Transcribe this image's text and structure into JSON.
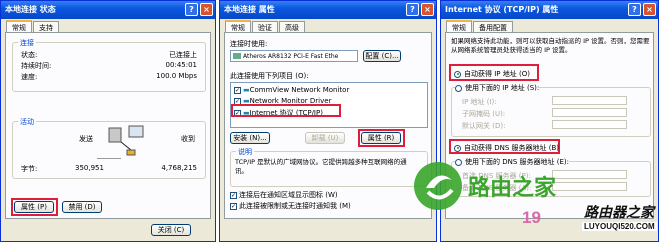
{
  "w1": {
    "title": "本地连接 状态",
    "tabs": [
      "常规",
      "支持"
    ],
    "group_conn": "连接",
    "status_lbl": "状态:",
    "status_val": "已连接上",
    "dur_lbl": "持续时间:",
    "dur_val": "00:45:01",
    "speed_lbl": "速度:",
    "speed_val": "100.0 Mbps",
    "group_act": "活动",
    "sent": "发送",
    "recv": "收到",
    "bytes_lbl": "字节:",
    "bytes_sent": "350,951",
    "bytes_recv": "4,768,215",
    "props": "属性 (P)",
    "disable": "禁用 (D)",
    "close": "关闭 (C)"
  },
  "w2": {
    "title": "本地连接 属性",
    "tabs": [
      "常规",
      "验证",
      "高级"
    ],
    "connect_using": "连接时使用:",
    "adapter": "Atheros AR8132 PCI-E Fast Ethe",
    "configure": "配置 (C)...",
    "items_label": "此连接使用下列项目 (O):",
    "items": [
      "CommView Network Monitor",
      "Network Monitor Driver",
      "Internet 协议 (TCP/IP)"
    ],
    "install": "安装 (N)...",
    "uninstall": "卸载 (U)",
    "props": "属性 (R)",
    "desc_group": "说明",
    "desc": "TCP/IP 是默认的广域网协议。它提供跨越多种互联网络的通讯。",
    "chk1": "连接后在通知区域显示图标 (W)",
    "chk2": "此连接被限制或无连接时通知我 (M)"
  },
  "w3": {
    "title": "Internet 协议 (TCP/IP) 属性",
    "tabs": [
      "常规",
      "备用配置"
    ],
    "intro": "如果网络支持此功能，则可以获取自动指派的 IP 设置。否则，您需要从网络系统管理员处获得适当的 IP 设置。",
    "auto_ip": "自动获得 IP 地址 (O)",
    "manual_ip": "使用下面的 IP 地址 (S):",
    "ip": "IP 地址 (I):",
    "mask": "子网掩码 (U):",
    "gw": "默认网关 (D):",
    "auto_dns": "自动获得 DNS 服务器地址 (B)",
    "manual_dns": "使用下面的 DNS 服务器地址 (E):",
    "dns1": "首选 DNS 服务器 (P):",
    "dns2": "备用 DNS 服务器 (A):"
  },
  "wm": {
    "brand": "路由之家",
    "num": "19",
    "big": "路由器之家",
    "url": "LUYOUQI520.COM"
  }
}
